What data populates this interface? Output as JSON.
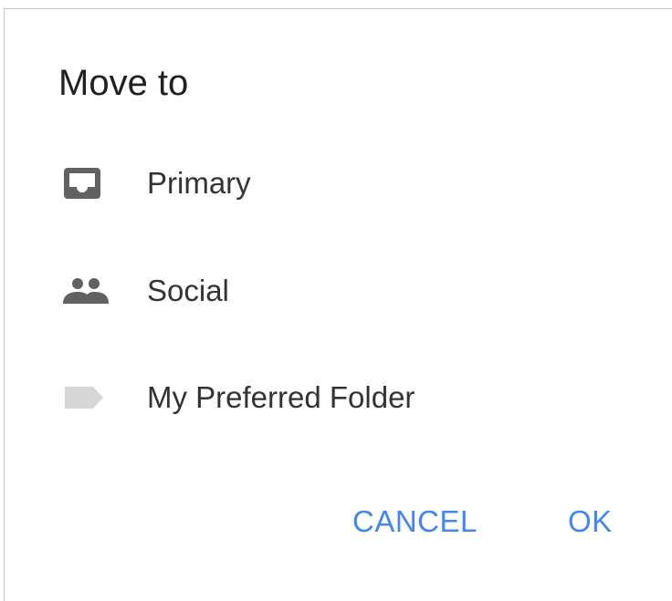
{
  "dialog": {
    "title": "Move to",
    "items": [
      {
        "label": "Primary",
        "icon": "inbox-icon"
      },
      {
        "label": "Social",
        "icon": "people-icon"
      },
      {
        "label": "My Preferred Folder",
        "icon": "label-tag-icon"
      }
    ],
    "actions": {
      "cancel_label": "CANCEL",
      "ok_label": "OK"
    }
  },
  "colors": {
    "accent": "#4285f4",
    "icon_dark": "#616161",
    "icon_light": "#d6d6d6",
    "text": "#333333",
    "title": "#212121"
  }
}
